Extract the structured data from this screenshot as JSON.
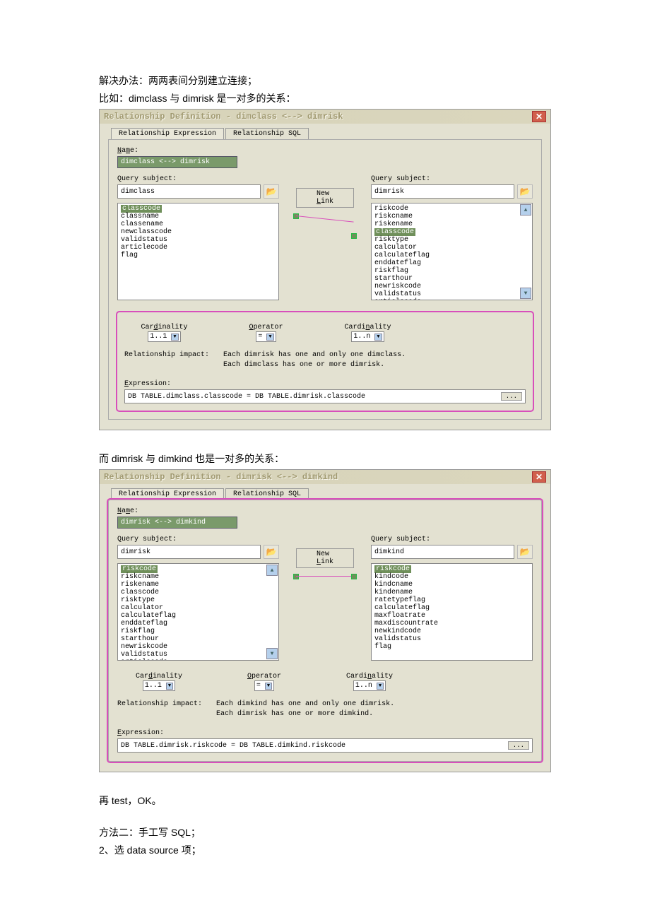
{
  "doc": {
    "line1": "解决办法：两两表间分别建立连接；",
    "line2": "比如：dimclass 与 dimrisk 是一对多的关系：",
    "line3": "而 dimrisk 与 dimkind 也是一对多的关系：",
    "line4": "再 test，OK。",
    "line5": "方法二：手工写 SQL；",
    "line6": "2、选 data source 项；"
  },
  "d1": {
    "title": "Relationship Definition - dimclass <--> dimrisk",
    "tabs": {
      "expr": "Relationship Expression",
      "sql": "Relationship SQL"
    },
    "name_label": "Name:",
    "name_value": "dimclass <--> dimrisk",
    "qs_label": "Query subject:",
    "left_subject": "dimclass",
    "right_subject": "dimrisk",
    "new_link": "New Link",
    "left_fields": [
      "classcode",
      "classname",
      "classename",
      "newclasscode",
      "validstatus",
      "articlecode",
      "flag"
    ],
    "right_fields": [
      "riskcode",
      "riskcname",
      "riskename",
      "classcode",
      "risktype",
      "calculator",
      "calculateflag",
      "enddateflag",
      "riskflag",
      "starthour",
      "newriskcode",
      "validstatus",
      "articlecode"
    ],
    "left_sel": "classcode",
    "right_sel": "classcode",
    "card_label_l": "Cardinality",
    "card_label_m": "Operator",
    "card_label_r": "Cardinality",
    "card_l": "1..1",
    "op": "=",
    "card_r": "1..n",
    "impact_label": "Relationship impact:",
    "impact_l1": "Each dimrisk has one and only one dimclass.",
    "impact_l2": "Each dimclass has one or more dimrisk.",
    "expr_label": "Expression:",
    "expr_val": "DB TABLE.dimclass.classcode = DB TABLE.dimrisk.classcode"
  },
  "d2": {
    "title": "Relationship Definition - dimrisk <--> dimkind",
    "tabs": {
      "expr": "Relationship Expression",
      "sql": "Relationship SQL"
    },
    "name_label": "Name:",
    "name_value": "dimrisk <--> dimkind",
    "qs_label": "Query subject:",
    "left_subject": "dimrisk",
    "right_subject": "dimkind",
    "new_link": "New Link",
    "left_fields": [
      "riskcode",
      "riskcname",
      "riskename",
      "classcode",
      "risktype",
      "calculator",
      "calculateflag",
      "enddateflag",
      "riskflag",
      "starthour",
      "newriskcode",
      "validstatus",
      "articlecode"
    ],
    "right_fields": [
      "riskcode",
      "kindcode",
      "kindcname",
      "kindename",
      "ratetypeflag",
      "calculateflag",
      "maxfloatrate",
      "maxdiscountrate",
      "newkindcode",
      "validstatus",
      "flag"
    ],
    "left_sel": "riskcode",
    "right_sel": "riskcode",
    "card_label_l": "Cardinality",
    "card_label_m": "Operator",
    "card_label_r": "Cardinality",
    "card_l": "1..1",
    "op": "=",
    "card_r": "1..n",
    "impact_label": "Relationship impact:",
    "impact_l1": "Each dimkind has one and only one dimrisk.",
    "impact_l2": "Each dimrisk has one or more dimkind.",
    "expr_label": "Expression:",
    "expr_val": "DB TABLE.dimrisk.riskcode = DB TABLE.dimkind.riskcode"
  },
  "glyphs": {
    "close": "✕",
    "folder": "📂",
    "up": "▲",
    "dn": "▼"
  }
}
